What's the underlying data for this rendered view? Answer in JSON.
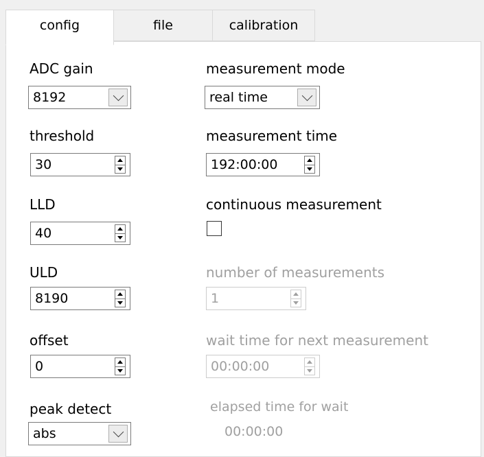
{
  "tabs": [
    "config",
    "file",
    "calibration"
  ],
  "left": {
    "adc_gain": {
      "label": "ADC gain",
      "value": "8192"
    },
    "threshold": {
      "label": "threshold",
      "value": "30"
    },
    "lld": {
      "label": "LLD",
      "value": "40"
    },
    "uld": {
      "label": "ULD",
      "value": "8190"
    },
    "offset": {
      "label": "offset",
      "value": "0"
    },
    "peak_detect": {
      "label": "peak detect",
      "value": "abs"
    }
  },
  "right": {
    "measurement_mode": {
      "label": "measurement mode",
      "value": "real time"
    },
    "measurement_time": {
      "label": "measurement time",
      "value": "192:00:00"
    },
    "continuous": {
      "label": "continuous measurement",
      "checked": false
    },
    "number_of_measurements": {
      "label": "number of measurements",
      "value": "1"
    },
    "wait_time": {
      "label": "wait time for next measurement",
      "value": "00:00:00"
    },
    "elapsed_wait": {
      "label": "elapsed time for wait",
      "value": "00:00:00"
    }
  }
}
